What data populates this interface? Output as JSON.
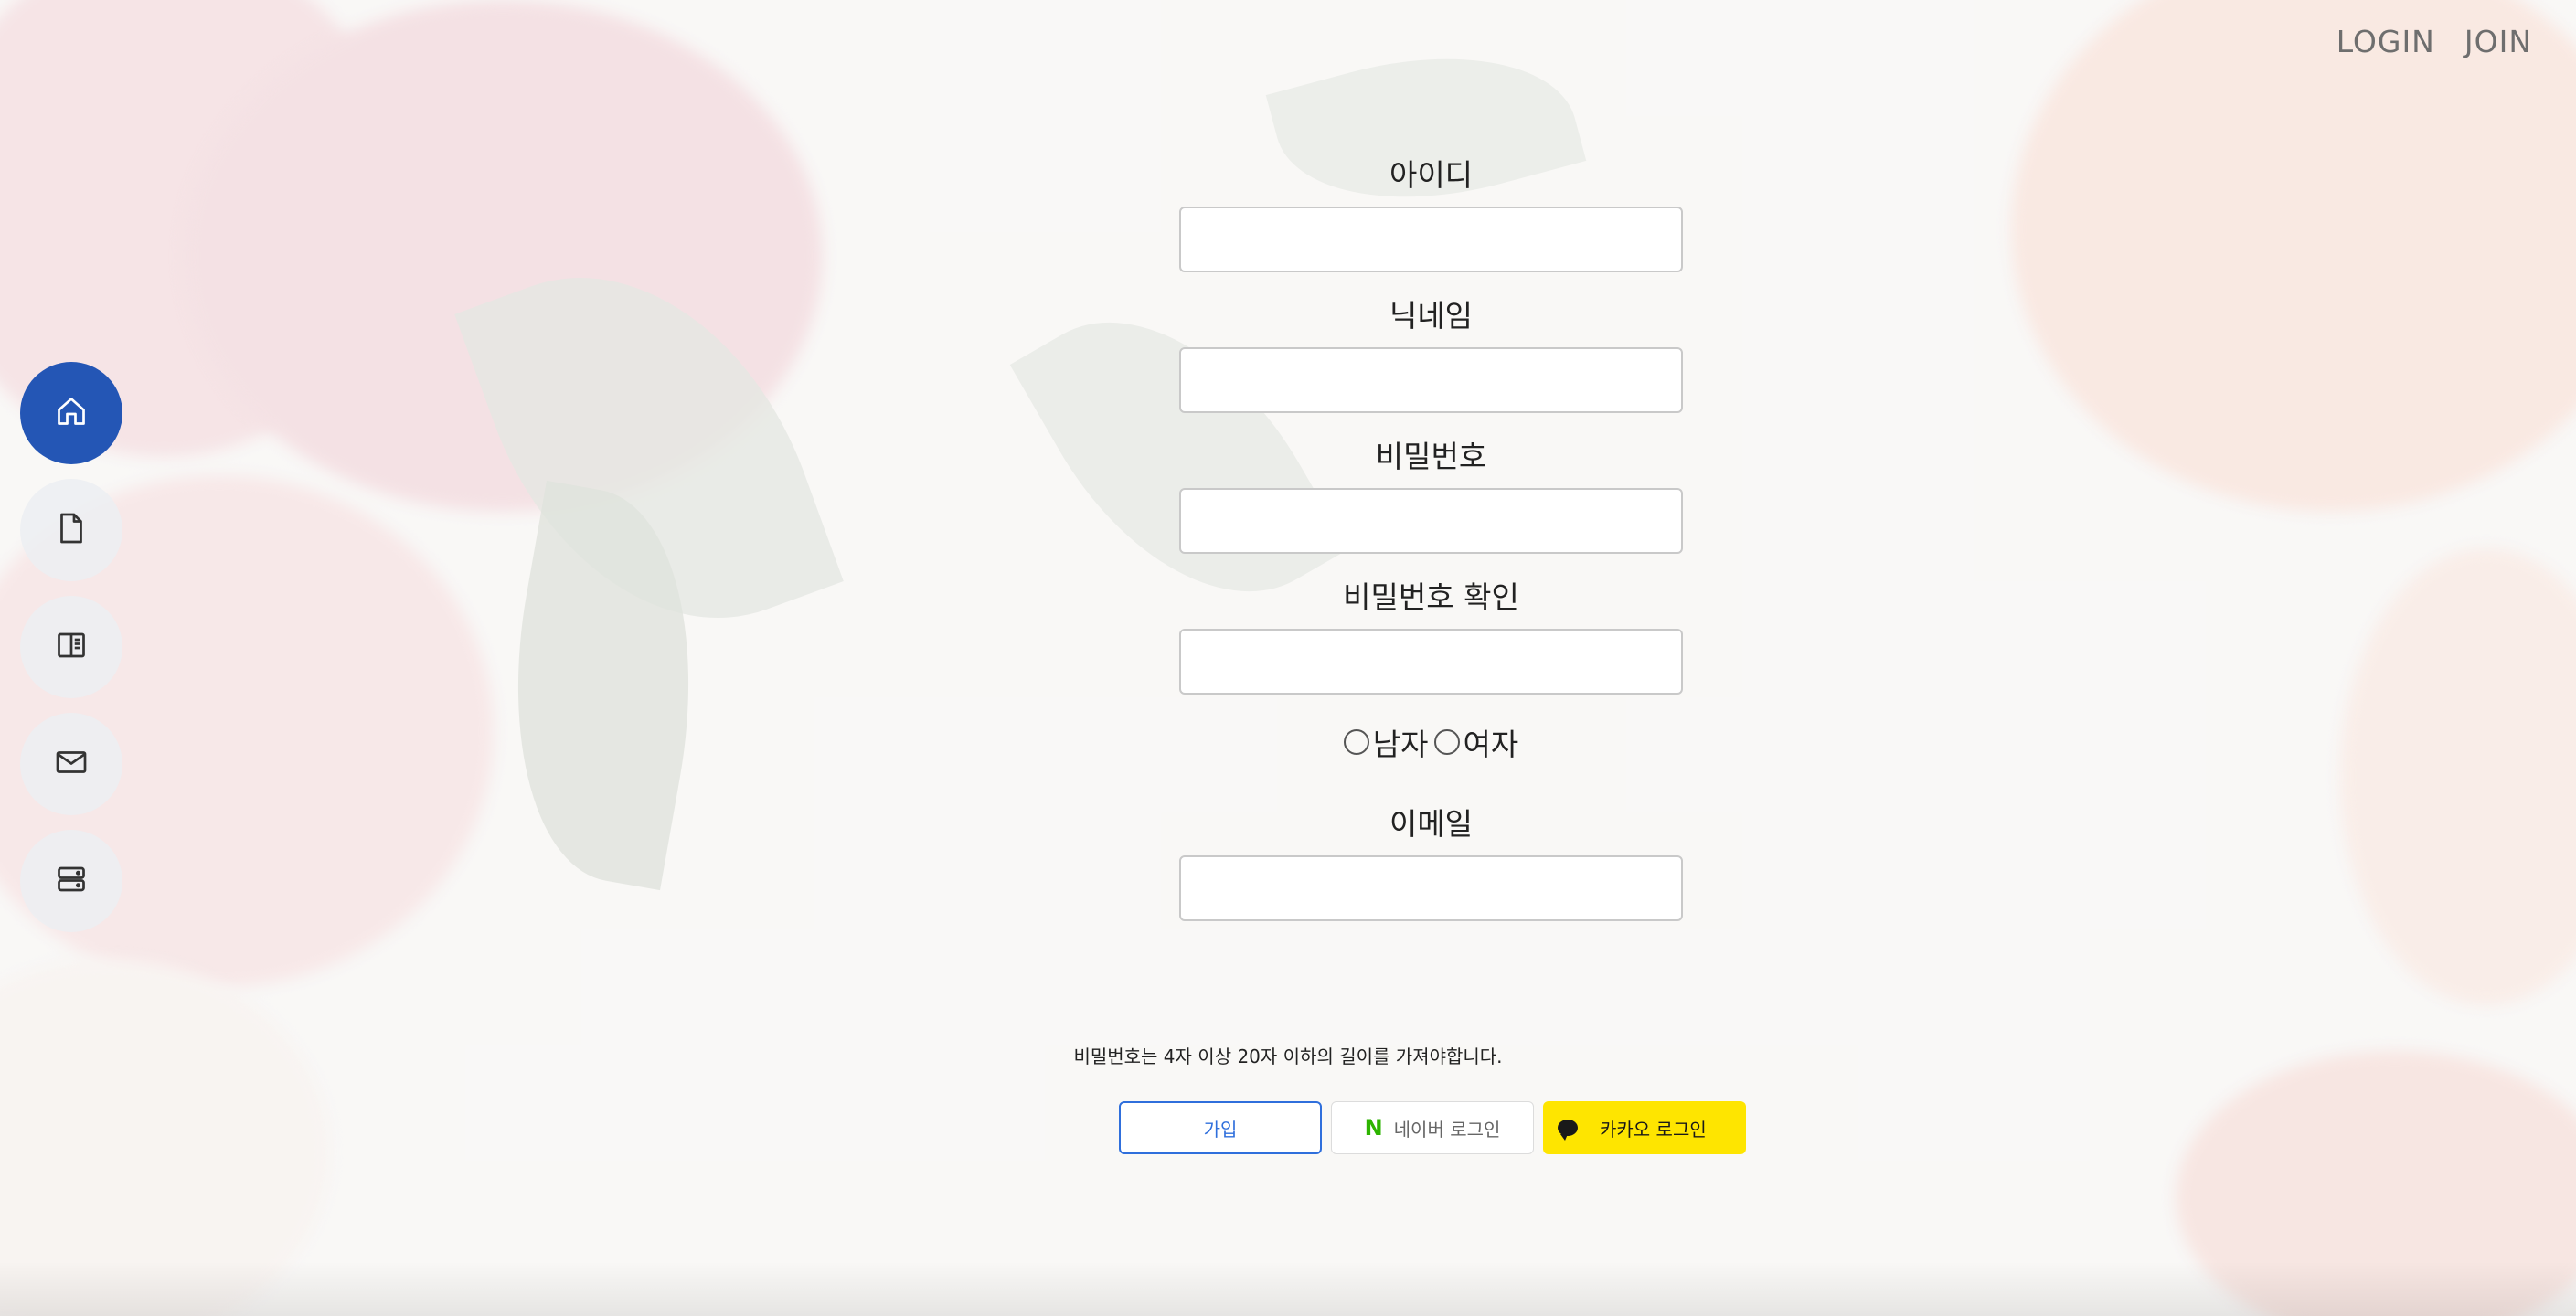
{
  "nav": {
    "login": "LOGIN",
    "join": "JOIN"
  },
  "sidebar": {
    "items": [
      {
        "icon": "home-icon",
        "active": true
      },
      {
        "icon": "document-icon",
        "active": false
      },
      {
        "icon": "book-icon",
        "active": false
      },
      {
        "icon": "mail-icon",
        "active": false
      },
      {
        "icon": "server-icon",
        "active": false
      }
    ],
    "active_color": "#2456b5"
  },
  "form": {
    "id_label": "아이디",
    "id_value": "",
    "nickname_label": "닉네임",
    "nickname_value": "",
    "password_label": "비밀번호",
    "password_value": "",
    "password_confirm_label": "비밀번호 확인",
    "password_confirm_value": "",
    "gender_male": "남자",
    "gender_female": "여자",
    "email_label": "이메일",
    "email_value": "",
    "hint": "비밀번호는 4자 이상 20자 이하의 길이를 가져야합니다."
  },
  "buttons": {
    "join": "가입",
    "naver_logo": "N",
    "naver": "네이버 로그인",
    "kakao": "카카오 로그인"
  },
  "colors": {
    "join_border": "#2f6fdc",
    "naver_green": "#2db400",
    "kakao_yellow": "#fee500"
  }
}
